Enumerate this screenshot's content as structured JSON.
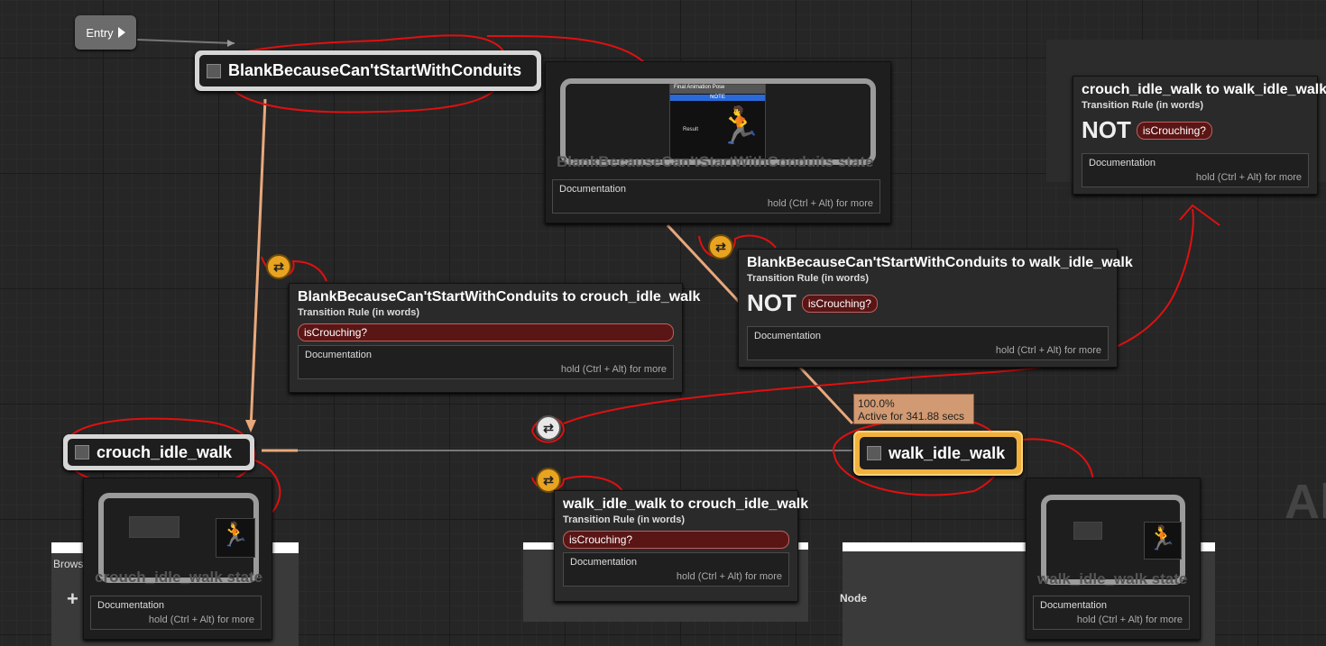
{
  "entry": {
    "label": "Entry"
  },
  "states": {
    "blank": {
      "label": "BlankBecauseCan'tStartWithConduits",
      "ghost": "BlankBecauseCan'tStartWithConduits state"
    },
    "crouch": {
      "label": "crouch_idle_walk",
      "ghost": "crouch_idle_walk state"
    },
    "walk": {
      "label": "walk_idle_walk",
      "ghost": "walk_idle_walk state"
    }
  },
  "final_pose": {
    "title": "Final Animation Pose",
    "note": "NOTE",
    "result": "Result"
  },
  "doc": {
    "label": "Documentation",
    "hint": "hold (Ctrl + Alt) for more"
  },
  "transitions": {
    "blank_to_crouch": {
      "title": "BlankBecauseCan'tStartWithConduits to crouch_idle_walk",
      "sub": "Transition Rule (in words)",
      "rule": "isCrouching?"
    },
    "blank_to_walk": {
      "title": "BlankBecauseCan'tStartWithConduits to walk_idle_walk",
      "sub": "Transition Rule (in words)",
      "not": "NOT",
      "rule": "isCrouching?"
    },
    "crouch_to_walk": {
      "title": "crouch_idle_walk to walk_idle_walk",
      "sub": "Transition Rule (in words)",
      "not": "NOT",
      "rule": "isCrouching?"
    },
    "walk_to_crouch": {
      "title": "walk_idle_walk to crouch_idle_walk",
      "sub": "Transition Rule (in words)",
      "rule": "isCrouching?"
    }
  },
  "active_status": {
    "percent": "100.0%",
    "time": "Active for 341.88 secs"
  },
  "bottom_ui": {
    "browse": "Brows",
    "plus": "+",
    "node": "Node",
    "watermark": "Al"
  },
  "colors": {
    "annotation": "#e01010",
    "active": "#f2b13c",
    "transition_badge": "#e8a320",
    "rule_fill": "#5a1515"
  }
}
